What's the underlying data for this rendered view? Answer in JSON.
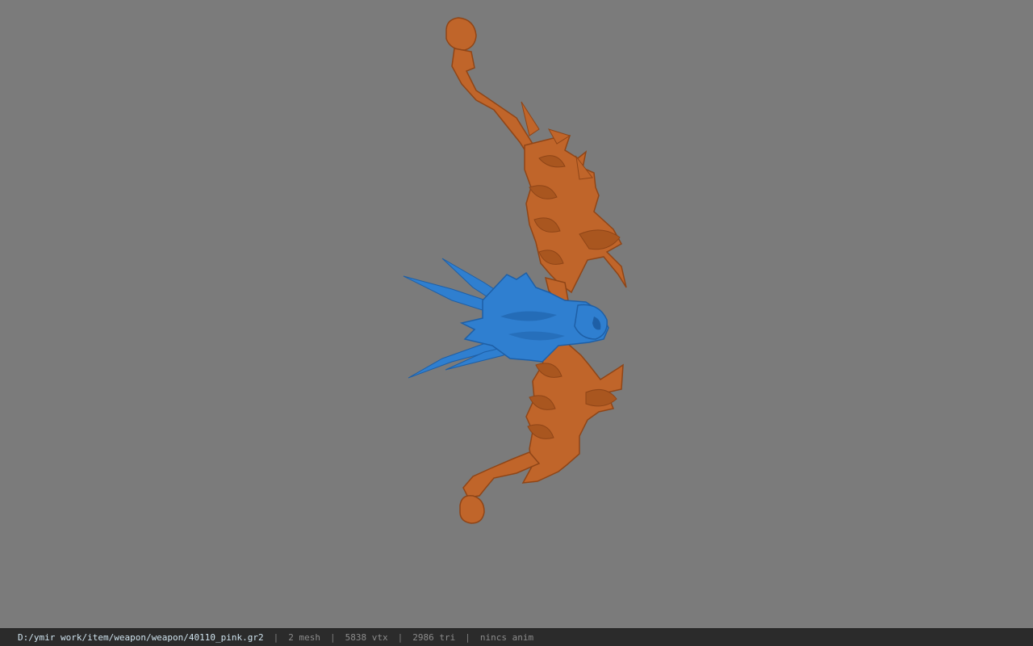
{
  "viewport": {
    "background": "#7b7b7b",
    "model": {
      "bow_color": "#c0652a",
      "bow_shade_color": "#8f4517",
      "bird_color": "#2f7fd0",
      "bird_shade_color": "#1e5fa6"
    }
  },
  "statusbar": {
    "file_path": "D:/ymir work/item/weapon/weapon/40110_pink.gr2",
    "separator": "|",
    "mesh_count": "2 mesh",
    "vertex_count": "5838 vtx",
    "triangle_count": "2986 tri",
    "anim_status": "nincs anim"
  }
}
